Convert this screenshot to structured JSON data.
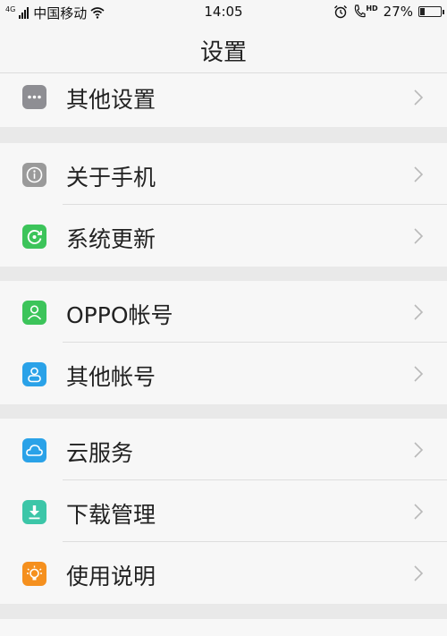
{
  "status_bar": {
    "signal_tag": "4G",
    "carrier": "中国移动",
    "time": "14:05",
    "hd_tag": "HD",
    "battery_percent": "27%",
    "battery_level": 0.27
  },
  "nav": {
    "title": "设置"
  },
  "groups": [
    {
      "items": [
        {
          "label": "其他设置",
          "icon": "more-dots-icon",
          "color": "#8e8e93"
        }
      ]
    },
    {
      "items": [
        {
          "label": "关于手机",
          "icon": "info-icon",
          "color": "#9a9a9a"
        },
        {
          "label": "系统更新",
          "icon": "update-icon",
          "color": "#3cc45a"
        }
      ]
    },
    {
      "items": [
        {
          "label": "OPPO帐号",
          "icon": "user-icon",
          "color": "#3cc45a"
        },
        {
          "label": "其他帐号",
          "icon": "account-icon",
          "color": "#2aa2e8"
        }
      ]
    },
    {
      "items": [
        {
          "label": "云服务",
          "icon": "cloud-icon",
          "color": "#2aa2e8"
        },
        {
          "label": "下载管理",
          "icon": "download-icon",
          "color": "#3cc6a8"
        },
        {
          "label": "使用说明",
          "icon": "lightbulb-icon",
          "color": "#f5901e"
        }
      ]
    }
  ]
}
